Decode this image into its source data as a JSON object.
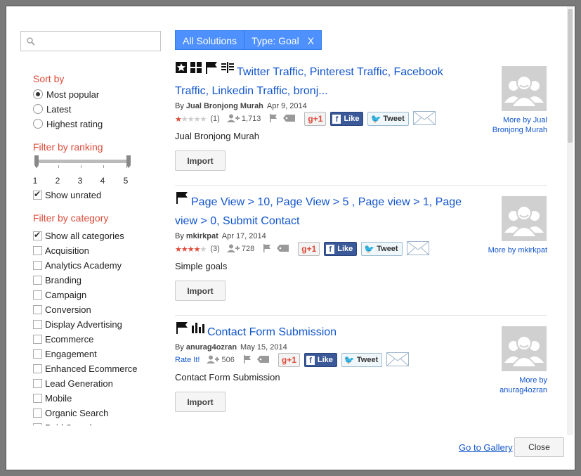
{
  "search": {
    "placeholder": "",
    "value": ""
  },
  "sort": {
    "title": "Sort by",
    "options": [
      "Most popular",
      "Latest",
      "Highest rating"
    ],
    "selected": 0
  },
  "ranking": {
    "title": "Filter by ranking",
    "ticks": [
      "1",
      "2",
      "3",
      "4",
      "5"
    ],
    "range": [
      1,
      5
    ],
    "show_unrated_label": "Show unrated",
    "show_unrated": true
  },
  "category": {
    "title": "Filter by category",
    "items": [
      {
        "label": "Show all categories",
        "checked": true
      },
      {
        "label": "Acquisition",
        "checked": false
      },
      {
        "label": "Analytics Academy",
        "checked": false
      },
      {
        "label": "Branding",
        "checked": false
      },
      {
        "label": "Campaign",
        "checked": false
      },
      {
        "label": "Conversion",
        "checked": false
      },
      {
        "label": "Display Advertising",
        "checked": false
      },
      {
        "label": "Ecommerce",
        "checked": false
      },
      {
        "label": "Engagement",
        "checked": false
      },
      {
        "label": "Enhanced Ecommerce",
        "checked": false
      },
      {
        "label": "Lead Generation",
        "checked": false
      },
      {
        "label": "Mobile",
        "checked": false
      },
      {
        "label": "Organic Search",
        "checked": false
      },
      {
        "label": "Paid Search",
        "checked": false
      }
    ]
  },
  "chips": {
    "all": "All Solutions",
    "type": "Type: Goal",
    "remove": "X"
  },
  "results": [
    {
      "icons": [
        "segment-icon",
        "dashboard-icon",
        "goal-flag-icon",
        "report-icon"
      ],
      "title_line1": "Twitter Traffic, Pinterest Traffic, Facebook",
      "title_line2": "Traffic, Linkedin Traffic, bronj...",
      "by": "By",
      "author": "Jual Bronjong Murah",
      "date": "Apr 9, 2014",
      "rating": 1,
      "rating_count": "(1)",
      "rate_label": "",
      "users": "1,713",
      "description": "Jual Bronjong Murah",
      "import": "Import",
      "more_line1": "More by Jual",
      "more_line2": "Bronjong Murah"
    },
    {
      "icons": [
        "goal-flag-icon"
      ],
      "title_line1": "Page View > 10, Page View > 5 , Page view > 1, Page",
      "title_line2": "view > 0, Submit Contact",
      "by": "By",
      "author": "mkirkpat",
      "date": "Apr 17, 2014",
      "rating": 4,
      "rating_count": "(3)",
      "rate_label": "",
      "users": "728",
      "description": "Simple goals",
      "import": "Import",
      "more_line1": "More by mkirkpat",
      "more_line2": ""
    },
    {
      "icons": [
        "goal-flag-icon",
        "report-icon"
      ],
      "title_line1": "Contact Form Submission",
      "title_line2": "",
      "by": "By",
      "author": "anurag4ozran",
      "date": "May 15, 2014",
      "rating": 0,
      "rating_count": "",
      "rate_label": "Rate It!",
      "users": "506",
      "description": "Contact Form Submission",
      "import": "Import",
      "more_line1": "More by",
      "more_line2": "anurag4ozran"
    }
  ],
  "share": {
    "gplus": "g+1",
    "like": "Like",
    "tweet": "Tweet"
  },
  "footer": {
    "gallery": "Go to Gallery",
    "close": "Close"
  }
}
